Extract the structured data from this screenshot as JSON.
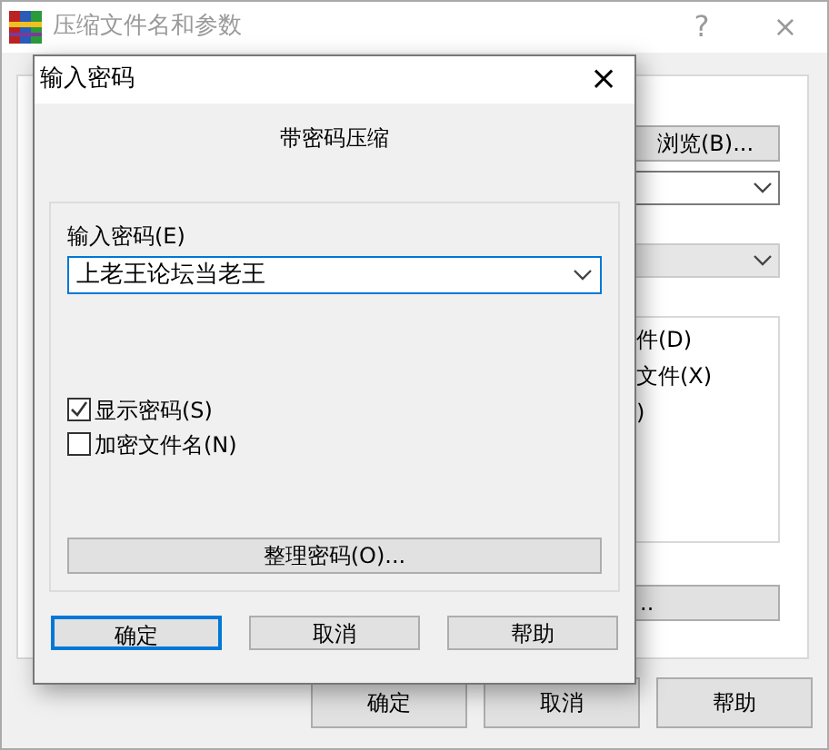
{
  "main_window": {
    "title": "压缩文件名和参数",
    "help_button": "?",
    "close_button": "×",
    "browse_button": "浏览(B)...",
    "list_fragments": [
      "件(D)",
      "文件(X)",
      ")"
    ],
    "button_fragment": "..",
    "buttons": [
      "确定",
      "取消",
      "帮助"
    ]
  },
  "dialog": {
    "title": "输入密码",
    "close_button": "×",
    "heading": "带密码压缩",
    "password_label": "输入密码(E)",
    "password_value": "上老王论坛当老王",
    "options": [
      {
        "label": "显示密码(S)",
        "checked": true
      },
      {
        "label": "加密文件名(N)",
        "checked": false
      }
    ],
    "manage_button": "整理密码(O)...",
    "buttons": [
      {
        "label": "确定",
        "default": true
      },
      {
        "label": "取消",
        "default": false
      },
      {
        "label": "帮助",
        "default": false
      }
    ]
  }
}
